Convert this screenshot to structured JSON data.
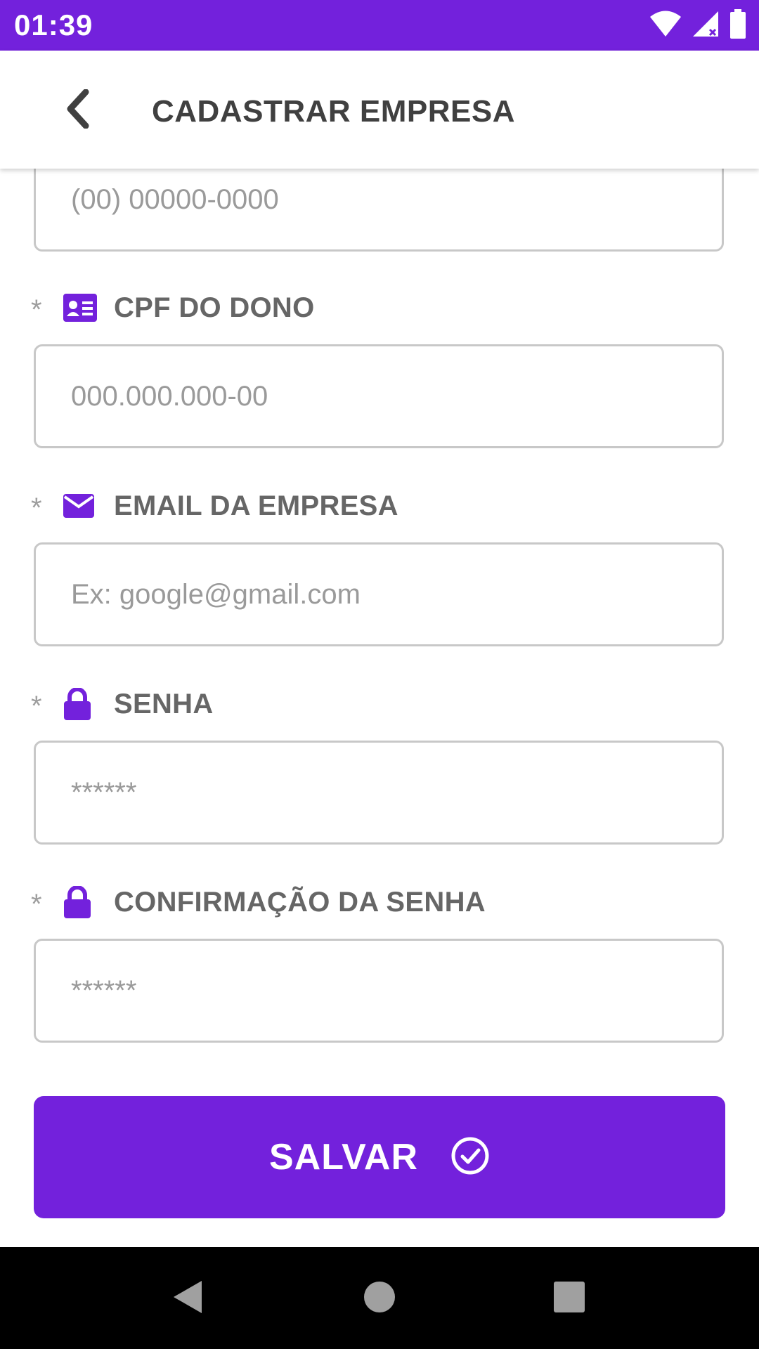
{
  "status_bar": {
    "time": "01:39"
  },
  "app_bar": {
    "title": "CADASTRAR EMPRESA"
  },
  "fields": {
    "phone": {
      "placeholder": "(00) 00000-0000"
    },
    "owner_cpf": {
      "required_mark": "*",
      "label": "CPF DO DONO",
      "icon": "id-card-icon",
      "placeholder": "000.000.000-00"
    },
    "company_email": {
      "required_mark": "*",
      "label": "EMAIL DA EMPRESA",
      "icon": "envelope-icon",
      "placeholder": "Ex: google@gmail.com"
    },
    "password": {
      "required_mark": "*",
      "label": "SENHA",
      "icon": "lock-icon",
      "placeholder": "******"
    },
    "password_confirm": {
      "required_mark": "*",
      "label": "CONFIRMAÇÃO DA SENHA",
      "icon": "lock-icon",
      "placeholder": "******"
    }
  },
  "save_button": {
    "label": "SALVAR",
    "icon": "check-circle-icon"
  },
  "colors": {
    "primary": "#7321dc",
    "label_gray": "#666666",
    "border": "#c8c8c8"
  }
}
